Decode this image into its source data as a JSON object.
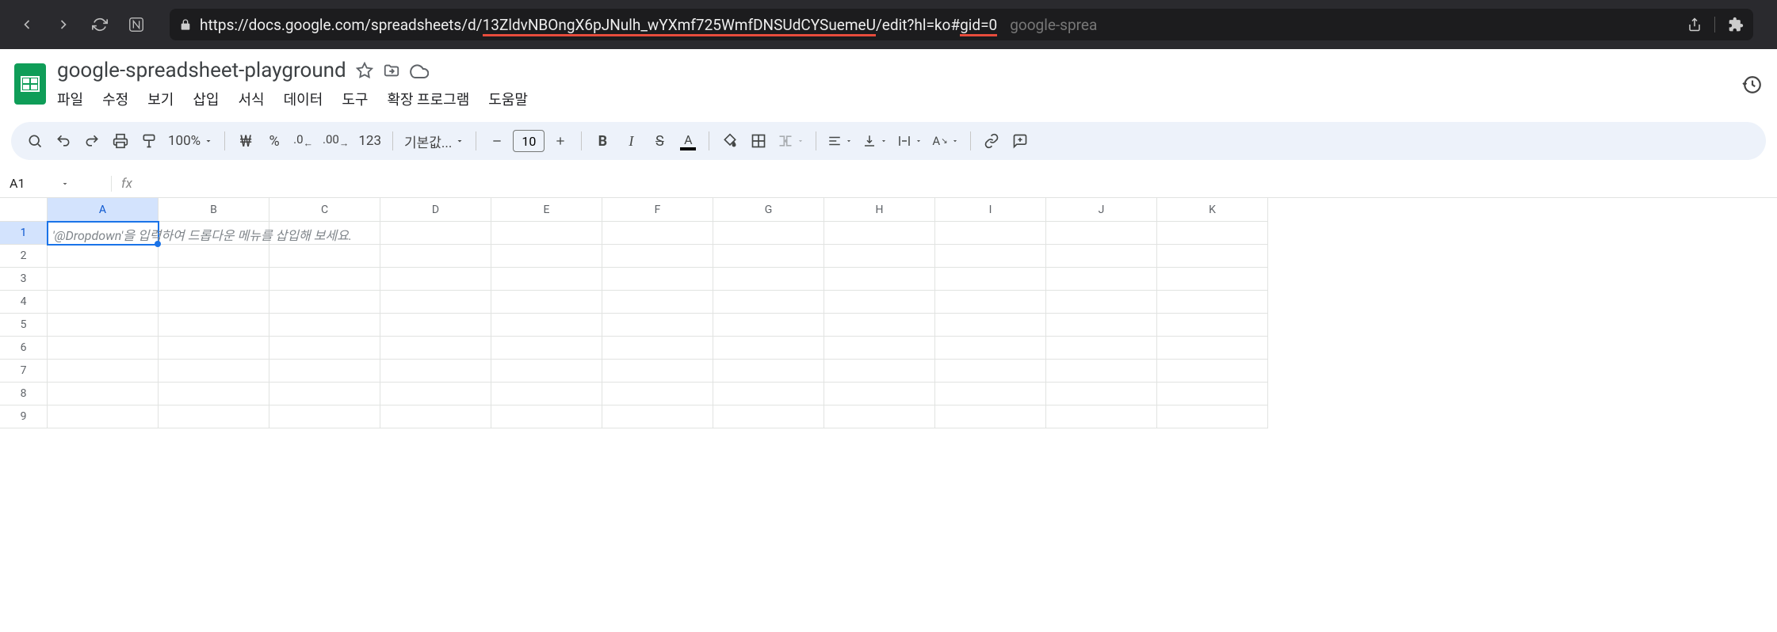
{
  "browser": {
    "url": "https://docs.google.com/spreadsheets/d/13ZldvNBOngX6pJNulh_wYXmf725WmfDNSUdCYSuemeU/edit?hl=ko#gid=0",
    "tab_hint": "google-sprea"
  },
  "doc": {
    "title": "google-spreadsheet-playground"
  },
  "menus": [
    "파일",
    "수정",
    "보기",
    "삽입",
    "서식",
    "데이터",
    "도구",
    "확장 프로그램",
    "도움말"
  ],
  "toolbar": {
    "zoom": "100%",
    "currency_symbol": "₩",
    "percent": "%",
    "number_format": "123",
    "font_label": "기본값...",
    "font_size": "10"
  },
  "name_box": "A1",
  "fx_label": "fx",
  "columns": [
    "A",
    "B",
    "C",
    "D",
    "E",
    "F",
    "G",
    "H",
    "I",
    "J",
    "K"
  ],
  "rows": [
    "1",
    "2",
    "3",
    "4",
    "5",
    "6",
    "7",
    "8",
    "9"
  ],
  "active_cell": "A1",
  "placeholder": "'@Dropdown'을 입력하여 드롭다운 메뉴를 삽입해 보세요."
}
